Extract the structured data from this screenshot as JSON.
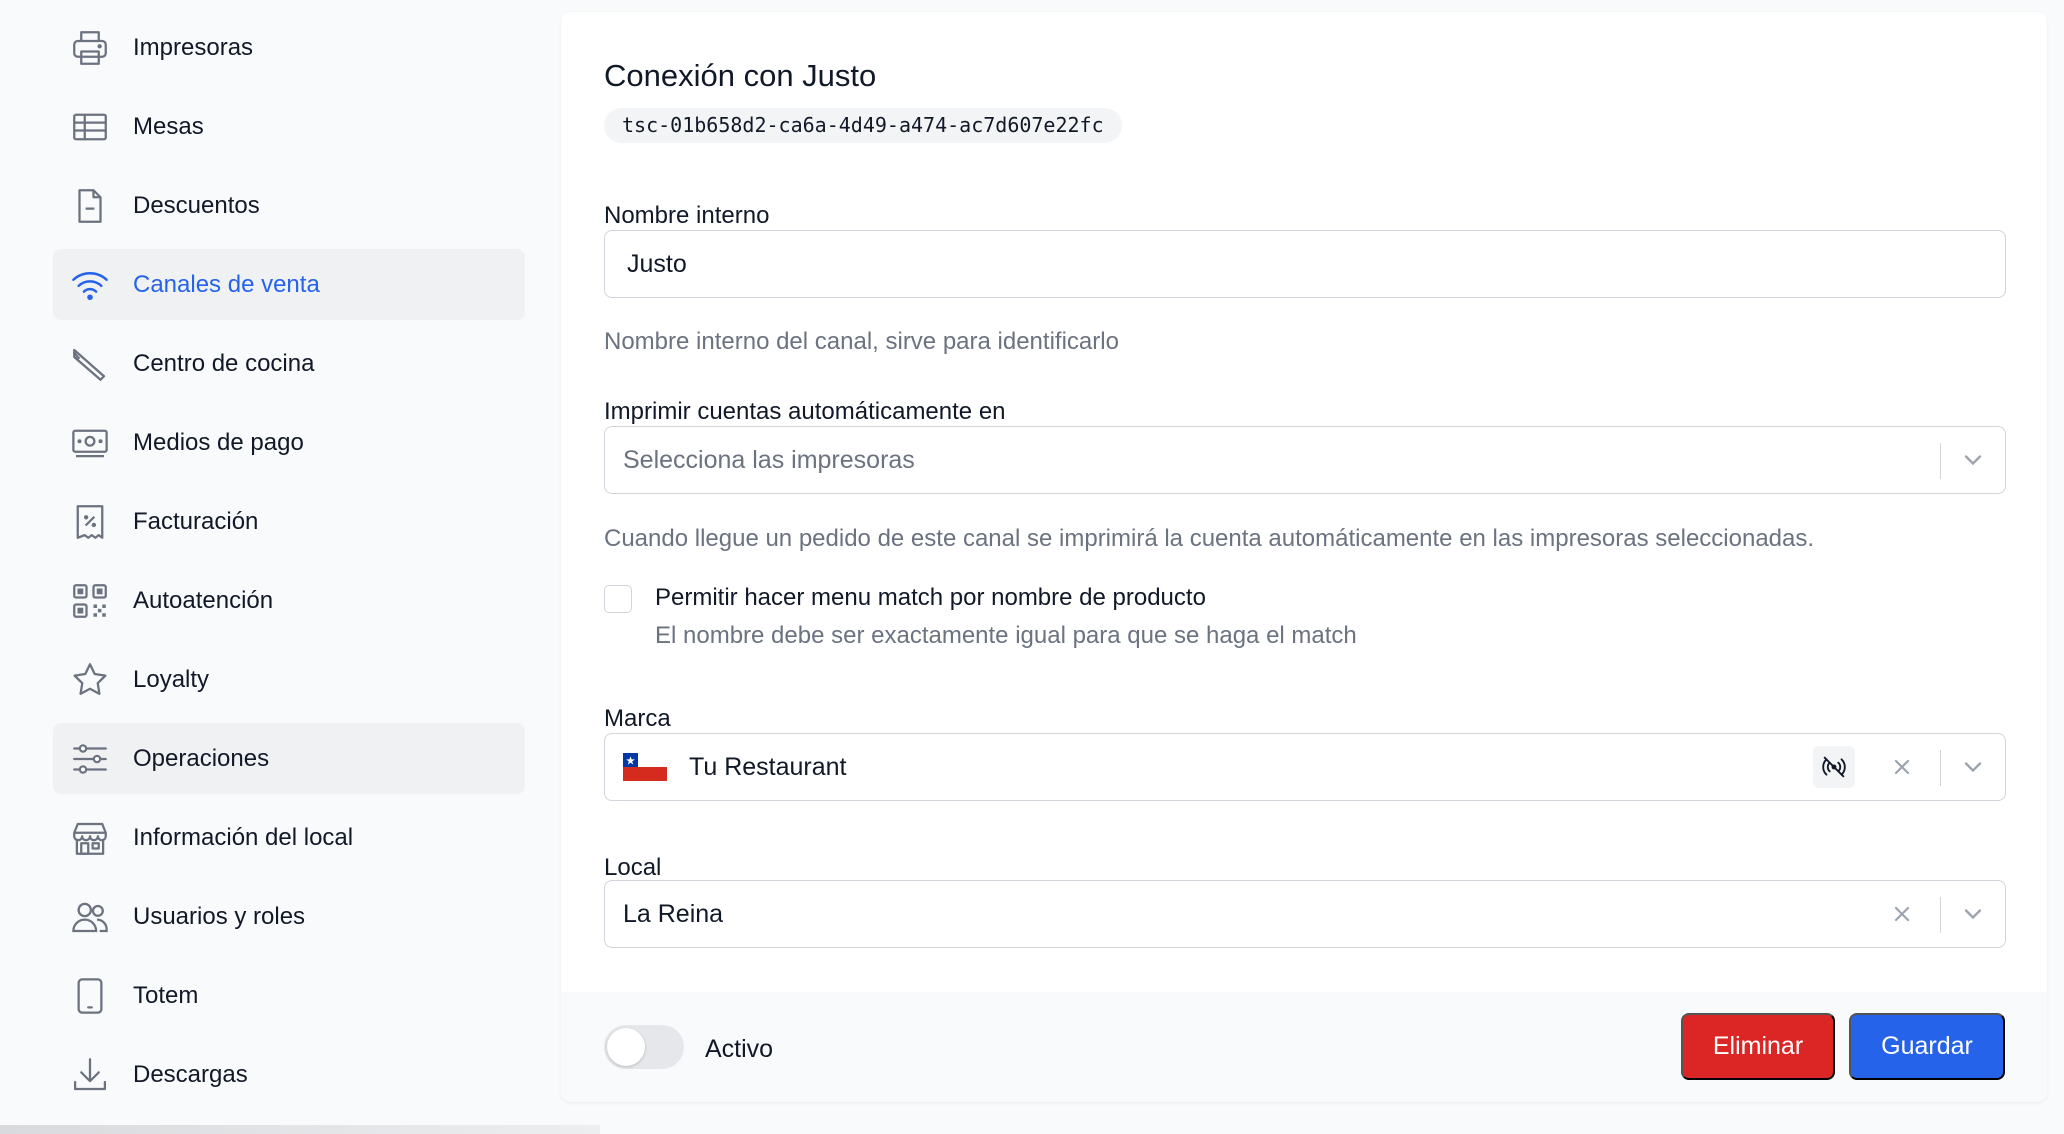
{
  "sidebar": {
    "items": [
      {
        "label": "Impresoras",
        "icon": "printer-icon"
      },
      {
        "label": "Mesas",
        "icon": "table-icon"
      },
      {
        "label": "Descuentos",
        "icon": "document-icon"
      },
      {
        "label": "Canales de venta",
        "icon": "wifi-icon",
        "active": true
      },
      {
        "label": "Centro de cocina",
        "icon": "knife-icon"
      },
      {
        "label": "Medios de pago",
        "icon": "cash-icon"
      },
      {
        "label": "Facturación",
        "icon": "receipt-icon"
      },
      {
        "label": "Autoatención",
        "icon": "qr-code-icon"
      },
      {
        "label": "Loyalty",
        "icon": "star-icon"
      },
      {
        "label": "Operaciones",
        "icon": "sliders-icon",
        "hovered": true
      },
      {
        "label": "Información del local",
        "icon": "store-icon"
      },
      {
        "label": "Usuarios y roles",
        "icon": "users-icon"
      },
      {
        "label": "Totem",
        "icon": "tablet-icon"
      },
      {
        "label": "Descargas",
        "icon": "download-icon"
      }
    ]
  },
  "form": {
    "title": "Conexión con Justo",
    "id": "tsc-01b658d2-ca6a-4d49-a474-ac7d607e22fc",
    "internal_name": {
      "label": "Nombre interno",
      "value": "Justo",
      "help": "Nombre interno del canal, sirve para identificarlo"
    },
    "auto_print": {
      "label": "Imprimir cuentas automáticamente en",
      "placeholder": "Selecciona las impresoras",
      "help": "Cuando llegue un pedido de este canal se imprimirá la cuenta automáticamente en las impresoras seleccionadas."
    },
    "menu_match": {
      "label": "Permitir hacer menu match por nombre de producto",
      "sub": "El nombre debe ser exactamente igual para que se haga el match",
      "checked": false
    },
    "brand": {
      "label": "Marca",
      "value": "Tu Restaurant",
      "flag": "chile-flag-icon"
    },
    "local": {
      "label": "Local",
      "value": "La Reina"
    }
  },
  "footer": {
    "toggle_label": "Activo",
    "toggle_on": false,
    "delete_label": "Eliminar",
    "save_label": "Guardar"
  },
  "colors": {
    "accent": "#2563eb",
    "danger": "#dc2626",
    "muted_text": "#6b7280"
  }
}
